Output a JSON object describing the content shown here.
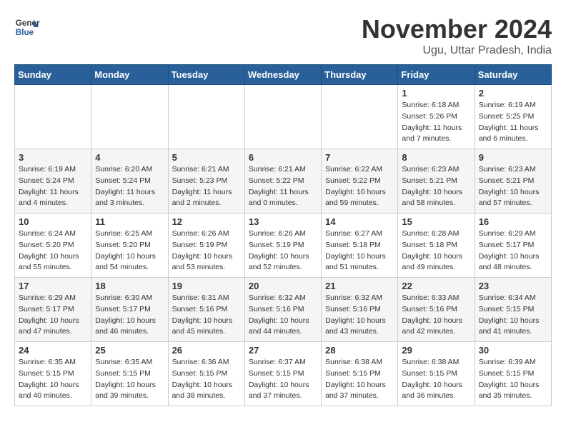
{
  "logo": {
    "text_general": "General",
    "text_blue": "Blue"
  },
  "title": "November 2024",
  "subtitle": "Ugu, Uttar Pradesh, India",
  "headers": [
    "Sunday",
    "Monday",
    "Tuesday",
    "Wednesday",
    "Thursday",
    "Friday",
    "Saturday"
  ],
  "weeks": [
    [
      {
        "day": "",
        "info": ""
      },
      {
        "day": "",
        "info": ""
      },
      {
        "day": "",
        "info": ""
      },
      {
        "day": "",
        "info": ""
      },
      {
        "day": "",
        "info": ""
      },
      {
        "day": "1",
        "info": "Sunrise: 6:18 AM\nSunset: 5:26 PM\nDaylight: 11 hours and 7 minutes."
      },
      {
        "day": "2",
        "info": "Sunrise: 6:19 AM\nSunset: 5:25 PM\nDaylight: 11 hours and 6 minutes."
      }
    ],
    [
      {
        "day": "3",
        "info": "Sunrise: 6:19 AM\nSunset: 5:24 PM\nDaylight: 11 hours and 4 minutes."
      },
      {
        "day": "4",
        "info": "Sunrise: 6:20 AM\nSunset: 5:24 PM\nDaylight: 11 hours and 3 minutes."
      },
      {
        "day": "5",
        "info": "Sunrise: 6:21 AM\nSunset: 5:23 PM\nDaylight: 11 hours and 2 minutes."
      },
      {
        "day": "6",
        "info": "Sunrise: 6:21 AM\nSunset: 5:22 PM\nDaylight: 11 hours and 0 minutes."
      },
      {
        "day": "7",
        "info": "Sunrise: 6:22 AM\nSunset: 5:22 PM\nDaylight: 10 hours and 59 minutes."
      },
      {
        "day": "8",
        "info": "Sunrise: 6:23 AM\nSunset: 5:21 PM\nDaylight: 10 hours and 58 minutes."
      },
      {
        "day": "9",
        "info": "Sunrise: 6:23 AM\nSunset: 5:21 PM\nDaylight: 10 hours and 57 minutes."
      }
    ],
    [
      {
        "day": "10",
        "info": "Sunrise: 6:24 AM\nSunset: 5:20 PM\nDaylight: 10 hours and 55 minutes."
      },
      {
        "day": "11",
        "info": "Sunrise: 6:25 AM\nSunset: 5:20 PM\nDaylight: 10 hours and 54 minutes."
      },
      {
        "day": "12",
        "info": "Sunrise: 6:26 AM\nSunset: 5:19 PM\nDaylight: 10 hours and 53 minutes."
      },
      {
        "day": "13",
        "info": "Sunrise: 6:26 AM\nSunset: 5:19 PM\nDaylight: 10 hours and 52 minutes."
      },
      {
        "day": "14",
        "info": "Sunrise: 6:27 AM\nSunset: 5:18 PM\nDaylight: 10 hours and 51 minutes."
      },
      {
        "day": "15",
        "info": "Sunrise: 6:28 AM\nSunset: 5:18 PM\nDaylight: 10 hours and 49 minutes."
      },
      {
        "day": "16",
        "info": "Sunrise: 6:29 AM\nSunset: 5:17 PM\nDaylight: 10 hours and 48 minutes."
      }
    ],
    [
      {
        "day": "17",
        "info": "Sunrise: 6:29 AM\nSunset: 5:17 PM\nDaylight: 10 hours and 47 minutes."
      },
      {
        "day": "18",
        "info": "Sunrise: 6:30 AM\nSunset: 5:17 PM\nDaylight: 10 hours and 46 minutes."
      },
      {
        "day": "19",
        "info": "Sunrise: 6:31 AM\nSunset: 5:16 PM\nDaylight: 10 hours and 45 minutes."
      },
      {
        "day": "20",
        "info": "Sunrise: 6:32 AM\nSunset: 5:16 PM\nDaylight: 10 hours and 44 minutes."
      },
      {
        "day": "21",
        "info": "Sunrise: 6:32 AM\nSunset: 5:16 PM\nDaylight: 10 hours and 43 minutes."
      },
      {
        "day": "22",
        "info": "Sunrise: 6:33 AM\nSunset: 5:16 PM\nDaylight: 10 hours and 42 minutes."
      },
      {
        "day": "23",
        "info": "Sunrise: 6:34 AM\nSunset: 5:15 PM\nDaylight: 10 hours and 41 minutes."
      }
    ],
    [
      {
        "day": "24",
        "info": "Sunrise: 6:35 AM\nSunset: 5:15 PM\nDaylight: 10 hours and 40 minutes."
      },
      {
        "day": "25",
        "info": "Sunrise: 6:35 AM\nSunset: 5:15 PM\nDaylight: 10 hours and 39 minutes."
      },
      {
        "day": "26",
        "info": "Sunrise: 6:36 AM\nSunset: 5:15 PM\nDaylight: 10 hours and 38 minutes."
      },
      {
        "day": "27",
        "info": "Sunrise: 6:37 AM\nSunset: 5:15 PM\nDaylight: 10 hours and 37 minutes."
      },
      {
        "day": "28",
        "info": "Sunrise: 6:38 AM\nSunset: 5:15 PM\nDaylight: 10 hours and 37 minutes."
      },
      {
        "day": "29",
        "info": "Sunrise: 6:38 AM\nSunset: 5:15 PM\nDaylight: 10 hours and 36 minutes."
      },
      {
        "day": "30",
        "info": "Sunrise: 6:39 AM\nSunset: 5:15 PM\nDaylight: 10 hours and 35 minutes."
      }
    ]
  ]
}
